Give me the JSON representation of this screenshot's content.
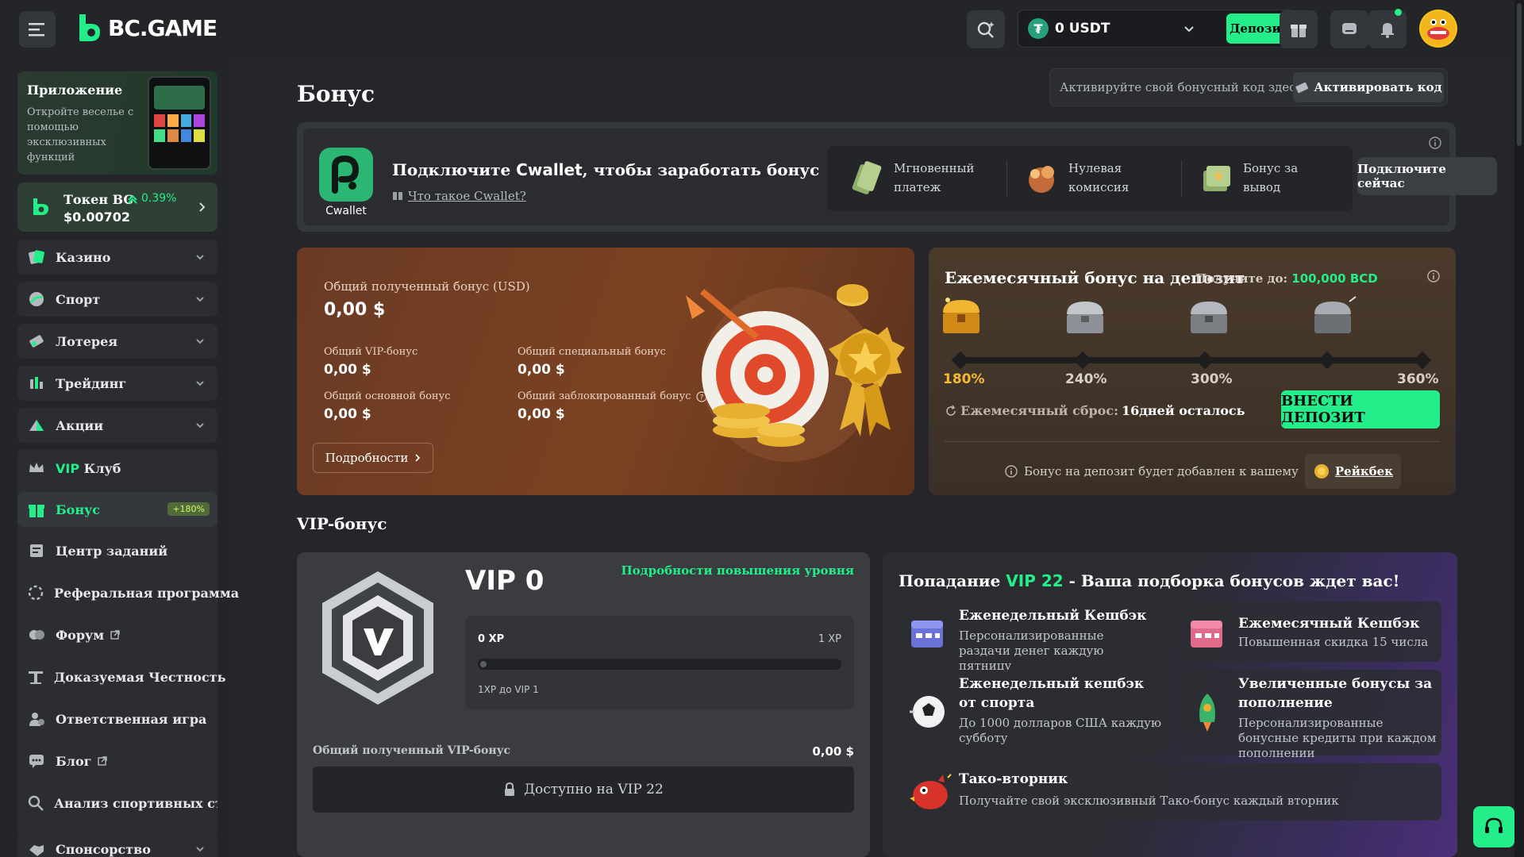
{
  "header": {
    "logo_text": "BC.GAME",
    "balance": "0 USDT",
    "deposit_label": "Депозит"
  },
  "sidebar": {
    "app_card": {
      "title": "Приложение",
      "desc": "Откройте веселье с помощью эксклюзивных функций"
    },
    "token": {
      "name": "Токен BC",
      "change": "0.39%",
      "price": "$0.00702"
    },
    "items": [
      {
        "label": "Казино",
        "icon": "casino-icon",
        "expand": true
      },
      {
        "label": "Спорт",
        "icon": "sport-icon",
        "expand": true
      },
      {
        "label": "Лотерея",
        "icon": "lottery-icon",
        "expand": true
      },
      {
        "label": "Трейдинг",
        "icon": "trading-icon",
        "expand": true
      },
      {
        "label": "Акции",
        "icon": "promotions-icon",
        "expand": true
      }
    ],
    "vip_prefix": "VIP",
    "vip_label": "Клуб",
    "bonus_label": "Бонус",
    "bonus_badge": "+180%",
    "tasks_label": "Центр заданий",
    "referral_label": "Реферальная программа",
    "forum_label": "Форум",
    "fair_label": "Доказуемая Честность",
    "responsible_label": "Ответственная игра",
    "blog_label": "Блог",
    "analysis_label": "Анализ спортивных ставо",
    "sponsor_label": "Спонсорство"
  },
  "main": {
    "title": "Бонус",
    "promo_text": "Активируйте свой бонусный код здесь.",
    "promo_button": "Активировать код",
    "cwallet": {
      "logo_caption": "Cwallet",
      "title_pre": "Подключите ",
      "title_brand": "Cwallet",
      "title_post": ", чтобы заработать бонус",
      "link": "Что такое Cwallet?",
      "features": [
        {
          "line1": "Мгновенный",
          "line2": "платеж"
        },
        {
          "line1": "Нулевая",
          "line2": "комиссия"
        },
        {
          "line1": "Бонус за",
          "line2": "вывод"
        }
      ],
      "connect": "Подключите сейчас"
    },
    "total_bonus": {
      "label": "Общий полученный бонус (USD)",
      "value": "0,00 $",
      "vip_label": "Общий VIP-бонус",
      "vip_value": "0,00 $",
      "special_label": "Общий специальный бонус",
      "special_value": "0,00 $",
      "base_label": "Общий основной бонус",
      "base_value": "0,00 $",
      "locked_label": "Общий заблокированный бонус",
      "locked_value": "0,00 $",
      "details": "Подробности"
    },
    "monthly": {
      "title": "Ежемесячный бонус на депозит",
      "sub_label": "Получите до:",
      "sub_value": "100,000 BCD",
      "tiers": [
        "180%",
        "240%",
        "300%",
        "360%"
      ],
      "reset_label": "Ежемесячный сброс:",
      "reset_value": "16дней осталось",
      "deposit": "ВНЕСТИ ДЕПОЗИТ",
      "note": "Бонус на депозит будет добавлен к вашему",
      "rakeback": "Рейкбек"
    },
    "vip_section_title": "VIP-бонус",
    "vip": {
      "level": "VIP 0",
      "upgrade_link": "Подробности повышения уровня",
      "xp_from": "0 XP",
      "xp_to": "1 XP",
      "xp_note": "1XP до VIP 1",
      "xp_progress": 0,
      "total_label": "Общий полученный VIP-бонус",
      "total_value": "0,00 $",
      "locked": "Доступно на VIP 22"
    },
    "perks": {
      "head_pre": "Попадание ",
      "head_vip": "VIP 22",
      "head_post": " - Ваша подборка бонусов ждет вас!",
      "items": [
        {
          "title": "Еженедельный Кешбэк",
          "desc": "Персонализированные раздачи денег каждую пятницу",
          "icon": "calendar-icon"
        },
        {
          "title": "Ежемесячный Кешбэк",
          "desc": "Повышенная скидка 15 числа",
          "icon": "calendar-icon"
        },
        {
          "title": "Еженедельный кешбэк от спорта",
          "desc": "До 1000 долларов США каждую субботу",
          "icon": "soccer-ball-icon"
        },
        {
          "title": "Увеличенные бонусы за пополнение",
          "desc": "Персонализированные бонусные кредиты при каждом пополнении",
          "icon": "rocket-icon"
        },
        {
          "title": "Тако-вторник",
          "desc": "Получайте свой эксклюзивный Тако-бонус каждый вторник",
          "icon": "dragon-icon"
        }
      ]
    }
  },
  "colors": {
    "accent": "#24ee89",
    "bg": "#24262b",
    "panel": "#2b2d32"
  }
}
